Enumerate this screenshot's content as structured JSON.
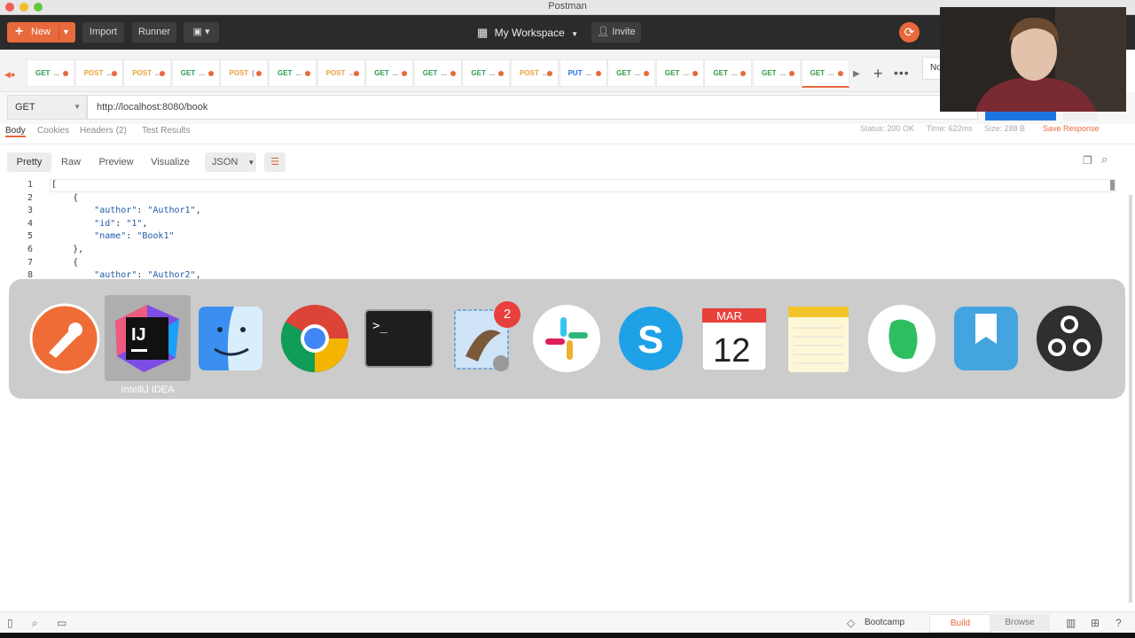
{
  "window": {
    "title": "Postman"
  },
  "header": {
    "new_label": "New",
    "import_label": "Import",
    "runner_label": "Runner",
    "workspace_label": "My Workspace",
    "invite_label": "Invite",
    "env_label": "No"
  },
  "tabs": [
    {
      "method": "GET",
      "name": "...",
      "color": "#2e9b4a"
    },
    {
      "method": "POST",
      "name": "...",
      "color": "#e8a23c"
    },
    {
      "method": "POST",
      "name": "...",
      "color": "#e8a23c"
    },
    {
      "method": "GET",
      "name": "...",
      "color": "#2e9b4a"
    },
    {
      "method": "POST",
      "name": "(",
      "color": "#e8a23c"
    },
    {
      "method": "GET",
      "name": "...",
      "color": "#2e9b4a"
    },
    {
      "method": "POST",
      "name": "...",
      "color": "#e8a23c"
    },
    {
      "method": "GET",
      "name": "...",
      "color": "#2e9b4a"
    },
    {
      "method": "GET",
      "name": "...",
      "color": "#2e9b4a"
    },
    {
      "method": "GET",
      "name": "...",
      "color": "#2e9b4a"
    },
    {
      "method": "POST",
      "name": "...",
      "color": "#e8a23c"
    },
    {
      "method": "PUT",
      "name": "...",
      "color": "#1e77e1"
    },
    {
      "method": "GET",
      "name": "...",
      "color": "#2e9b4a"
    },
    {
      "method": "GET",
      "name": "...",
      "color": "#2e9b4a"
    },
    {
      "method": "GET",
      "name": "...",
      "color": "#2e9b4a"
    },
    {
      "method": "GET",
      "name": "...",
      "color": "#2e9b4a"
    },
    {
      "method": "GET",
      "name": "...",
      "color": "#2e9b4a"
    }
  ],
  "request": {
    "method": "GET",
    "url": "http://localhost:8080/book"
  },
  "response": {
    "tabs": {
      "body": "Body",
      "cookies": "Cookies",
      "headers": "Headers (2)",
      "tests": "Test Results"
    },
    "status": "Status: 200 OK",
    "time": "Time: 622ms",
    "size": "Size: 288 B",
    "save": "Save Response",
    "views": {
      "pretty": "Pretty",
      "raw": "Raw",
      "preview": "Preview",
      "visualize": "Visualize"
    },
    "format": "JSON",
    "lines": [
      {
        "n": "1",
        "text": "["
      },
      {
        "n": "2",
        "text": "    {"
      },
      {
        "n": "3",
        "key": "\"author\"",
        "val": "\"Author1\"",
        "end": ","
      },
      {
        "n": "4",
        "key": "\"id\"",
        "val": "\"1\"",
        "end": ","
      },
      {
        "n": "5",
        "key": "\"name\"",
        "val": "\"Book1\"",
        "end": ""
      },
      {
        "n": "6",
        "text": "    },"
      },
      {
        "n": "7",
        "text": "    {"
      },
      {
        "n": "8",
        "key": "\"author\"",
        "val": "\"Author2\"",
        "end": ","
      }
    ]
  },
  "dock": {
    "hover_label": "IntelliJ IDEA",
    "mail_badge": "2",
    "calendar_month": "MAR",
    "calendar_day": "12",
    "ij_text": "IJ",
    "apps": [
      "postman",
      "intellij-idea",
      "finder",
      "chrome",
      "terminal",
      "mail",
      "slack",
      "skype",
      "calendar",
      "notes",
      "evernote",
      "day-one",
      "obs"
    ]
  },
  "statusbar": {
    "bootcamp": "Bootcamp",
    "build": "Build",
    "browse": "Browse"
  },
  "colors": {
    "accent": "#e8693c",
    "send": "#1e77e1",
    "header_bg": "#2b2b2b"
  }
}
